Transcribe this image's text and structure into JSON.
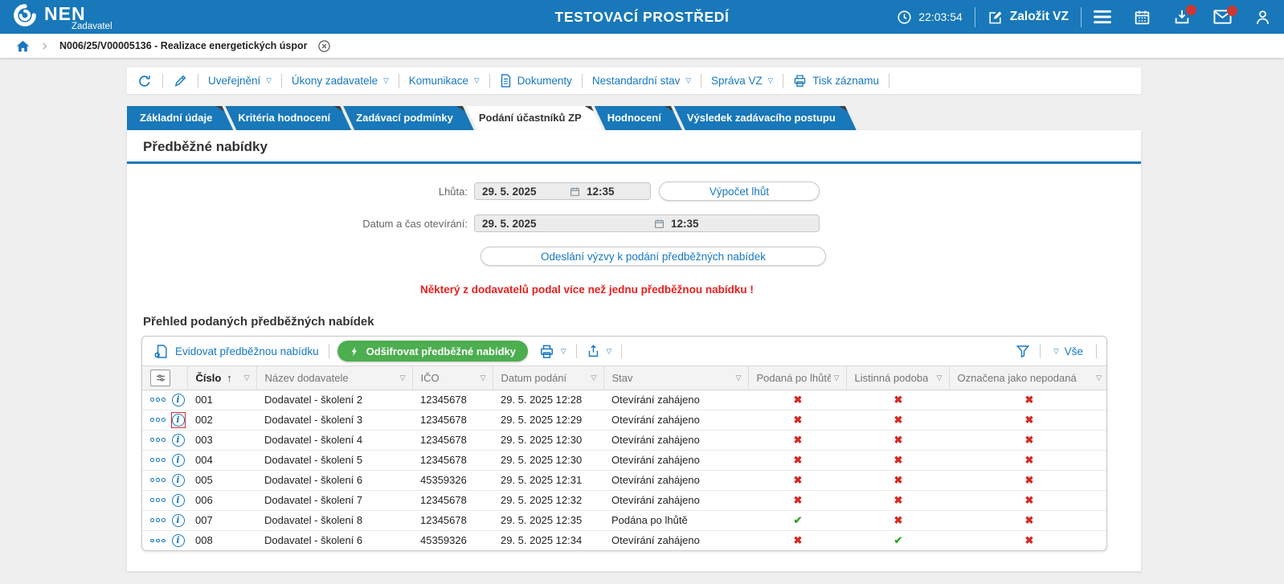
{
  "header": {
    "brand": "NEN",
    "brand_sub": "Zadavatel",
    "environment_title": "TESTOVACÍ PROSTŘEDÍ",
    "time": "22:03:54",
    "create_vz_label": "Založit VZ"
  },
  "breadcrumb": {
    "item": "N006/25/V00005136 - Realizace energetických úspor"
  },
  "record_toolbar": {
    "items": [
      {
        "label": "Uveřejnění"
      },
      {
        "label": "Úkony zadavatele"
      },
      {
        "label": "Komunikace"
      },
      {
        "label": "Dokumenty"
      },
      {
        "label": "Nestandardní stav"
      },
      {
        "label": "Správa VZ"
      },
      {
        "label": "Tisk záznamu"
      }
    ]
  },
  "tabs": [
    {
      "label": "Základní údaje",
      "active": false
    },
    {
      "label": "Kritéria hodnocení",
      "active": false
    },
    {
      "label": "Zadávací podmínky",
      "active": false
    },
    {
      "label": "Podání účastníků ZP",
      "active": true
    },
    {
      "label": "Hodnocení",
      "active": false
    },
    {
      "label": "Výsledek zadávacího postupu",
      "active": false
    }
  ],
  "section": {
    "title": "Předběžné nabídky",
    "deadline_label": "Lhůta:",
    "deadline_date": "29. 5. 2025",
    "deadline_time": "12:35",
    "compute_deadlines_button": "Výpočet lhůt",
    "opening_label": "Datum a čas otevírání:",
    "opening_date": "29. 5. 2025",
    "opening_time": "12:35",
    "send_invitation_button": "Odeslání výzvy k podání předběžných nabídek",
    "warning": "Některý z dodavatelů podal více než jednu předběžnou nabídku !"
  },
  "grid": {
    "title": "Přehled podaných předběžných nabídek",
    "toolbar": {
      "register_bid": "Evidovat předběžnou nabídku",
      "decrypt_bids": "Odšifrovat předběžné nabídky",
      "filter_value": "Vše"
    },
    "columns": [
      "Číslo",
      "Název dodavatele",
      "IČO",
      "Datum podání",
      "Stav",
      "Podaná po lhůtě",
      "Listinná podoba",
      "Označena jako nepodaná"
    ],
    "rows": [
      {
        "cislo": "001",
        "dodavatel": "Dodavatel - školení 2",
        "ico": "12345678",
        "datum": "29. 5. 2025 12:28",
        "stav": "Otevírání zahájeno",
        "po_lhute": false,
        "listinna": false,
        "nepodana": false,
        "highlight": false
      },
      {
        "cislo": "002",
        "dodavatel": "Dodavatel - školení 3",
        "ico": "12345678",
        "datum": "29. 5. 2025 12:29",
        "stav": "Otevírání zahájeno",
        "po_lhute": false,
        "listinna": false,
        "nepodana": false,
        "highlight": true
      },
      {
        "cislo": "003",
        "dodavatel": "Dodavatel - školení 4",
        "ico": "12345678",
        "datum": "29. 5. 2025 12:30",
        "stav": "Otevírání zahájeno",
        "po_lhute": false,
        "listinna": false,
        "nepodana": false,
        "highlight": false
      },
      {
        "cislo": "004",
        "dodavatel": "Dodavatel - školení 5",
        "ico": "12345678",
        "datum": "29. 5. 2025 12:30",
        "stav": "Otevírání zahájeno",
        "po_lhute": false,
        "listinna": false,
        "nepodana": false,
        "highlight": false
      },
      {
        "cislo": "005",
        "dodavatel": "Dodavatel - školení 6",
        "ico": "45359326",
        "datum": "29. 5. 2025 12:31",
        "stav": "Otevírání zahájeno",
        "po_lhute": false,
        "listinna": false,
        "nepodana": false,
        "highlight": false
      },
      {
        "cislo": "006",
        "dodavatel": "Dodavatel - školení 7",
        "ico": "12345678",
        "datum": "29. 5. 2025 12:32",
        "stav": "Otevírání zahájeno",
        "po_lhute": false,
        "listinna": false,
        "nepodana": false,
        "highlight": false
      },
      {
        "cislo": "007",
        "dodavatel": "Dodavatel - školení 8",
        "ico": "12345678",
        "datum": "29. 5. 2025 12:35",
        "stav": "Podána po lhůtě",
        "po_lhute": true,
        "listinna": false,
        "nepodana": false,
        "highlight": false
      },
      {
        "cislo": "008",
        "dodavatel": "Dodavatel - školení 6",
        "ico": "45359326",
        "datum": "29. 5. 2025 12:34",
        "stav": "Otevírání zahájeno",
        "po_lhute": false,
        "listinna": true,
        "nepodana": false,
        "highlight": false
      }
    ]
  },
  "colors": {
    "header_blue": "#1878ba",
    "link_blue": "#1778c2",
    "green": "#4cae4f",
    "red_cross": "#d42a24",
    "green_check": "#35a32c",
    "warning_red": "#e8201f"
  }
}
